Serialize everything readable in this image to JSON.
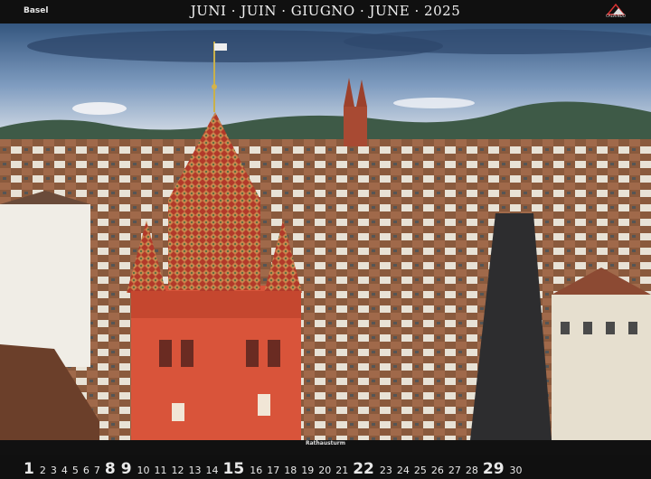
{
  "header": {
    "city": "Basel",
    "title": "JUNI · JUIN · GIUGNO · JUNE · 2025",
    "logo_text": "CALVENDO"
  },
  "photo": {
    "caption": "Rathausturm",
    "colors": {
      "sky_top": "#3a5f8f",
      "sky_bottom": "#c9d6e6",
      "tower_red": "#d9543a",
      "roof_tiles": "#b9412e",
      "hills": "#3e5a47"
    }
  },
  "calendar": {
    "days": [
      {
        "label": "1",
        "big": true
      },
      {
        "label": "2",
        "big": false
      },
      {
        "label": "3",
        "big": false
      },
      {
        "label": "4",
        "big": false
      },
      {
        "label": "5",
        "big": false
      },
      {
        "label": "6",
        "big": false
      },
      {
        "label": "7",
        "big": false
      },
      {
        "label": "8",
        "big": true
      },
      {
        "label": "9",
        "big": true
      },
      {
        "label": "10",
        "big": false
      },
      {
        "label": "11",
        "big": false
      },
      {
        "label": "12",
        "big": false
      },
      {
        "label": "13",
        "big": false
      },
      {
        "label": "14",
        "big": false
      },
      {
        "label": "15",
        "big": true
      },
      {
        "label": "16",
        "big": false
      },
      {
        "label": "17",
        "big": false
      },
      {
        "label": "18",
        "big": false
      },
      {
        "label": "19",
        "big": false
      },
      {
        "label": "20",
        "big": false
      },
      {
        "label": "21",
        "big": false
      },
      {
        "label": "22",
        "big": true
      },
      {
        "label": "23",
        "big": false
      },
      {
        "label": "24",
        "big": false
      },
      {
        "label": "25",
        "big": false
      },
      {
        "label": "26",
        "big": false
      },
      {
        "label": "27",
        "big": false
      },
      {
        "label": "28",
        "big": false
      },
      {
        "label": "29",
        "big": true
      },
      {
        "label": "30",
        "big": false
      }
    ]
  }
}
